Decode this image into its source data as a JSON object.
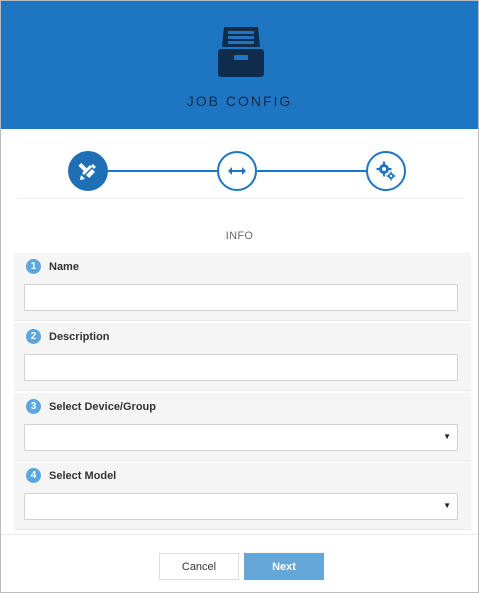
{
  "header": {
    "title": "JOB CONFIG",
    "icon": "file-cabinet-icon"
  },
  "stepper": {
    "steps": [
      {
        "icon": "edit-pencil-icon",
        "state": "active"
      },
      {
        "icon": "swap-arrows-icon",
        "state": "idle"
      },
      {
        "icon": "gears-icon",
        "state": "idle"
      }
    ]
  },
  "section": {
    "title": "INFO"
  },
  "fields": [
    {
      "number": "1",
      "label": "Name",
      "type": "text",
      "value": ""
    },
    {
      "number": "2",
      "label": "Description",
      "type": "text",
      "value": ""
    },
    {
      "number": "3",
      "label": "Select Device/Group",
      "type": "select",
      "value": ""
    },
    {
      "number": "4",
      "label": "Select Model",
      "type": "select",
      "value": ""
    }
  ],
  "footer": {
    "cancel_label": "Cancel",
    "next_label": "Next"
  },
  "colors": {
    "primary": "#1e76c3",
    "badge": "#5aa7e0",
    "next_button": "#64a6d8"
  }
}
